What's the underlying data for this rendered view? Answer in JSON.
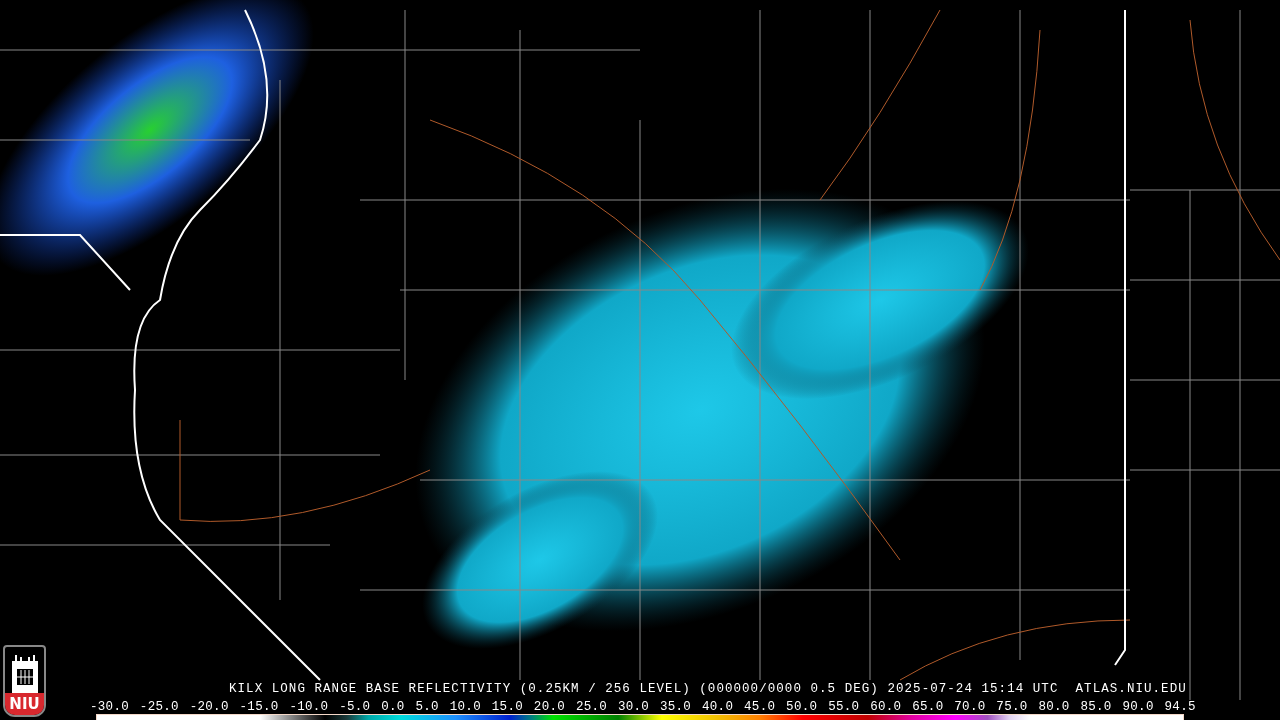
{
  "logo": {
    "text": "NIU"
  },
  "caption": "KILX LONG RANGE BASE REFLECTIVITY (0.25KM / 256 LEVEL) (000000/0000 0.5 DEG) 2025-07-24 15:14 UTC  ATLAS.NIU.EDU",
  "scale": {
    "labels": [
      "-30.0",
      "-25.0",
      "-20.0",
      "-15.0",
      "-10.0",
      "-5.0",
      "0.0",
      "5.0",
      "10.0",
      "15.0",
      "20.0",
      "25.0",
      "30.0",
      "35.0",
      "40.0",
      "45.0",
      "50.0",
      "55.0",
      "60.0",
      "65.0",
      "70.0",
      "75.0",
      "80.0",
      "85.0",
      "90.0",
      "94.5"
    ]
  }
}
